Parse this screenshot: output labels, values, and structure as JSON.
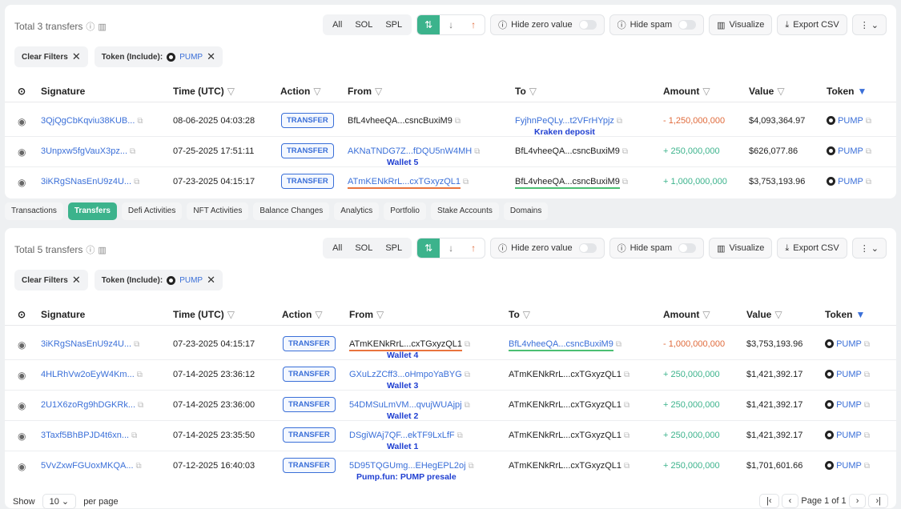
{
  "panel1": {
    "total": "Total 3 transfers",
    "chip_clear": "Clear Filters",
    "chip_token_label": "Token (Include):",
    "chip_token_value": "PUMP",
    "rows": [
      {
        "sig": "3QjQgCbKqviu38KUB...",
        "time": "08-06-2025 04:03:28",
        "action": "TRANSFER",
        "from": "BfL4vheeQA...csncBuxiM9",
        "to": "FyjhnPeQLy...t2VFrHYpjz",
        "amount": "- 1,250,000,000",
        "value": "$4,093,364.97",
        "token": "PUMP"
      },
      {
        "sig": "3Unpxw5fgVauX3pz...",
        "time": "07-25-2025 17:51:11",
        "action": "TRANSFER",
        "from": "AKNaTNDG7Z...fDQU5nW4MH",
        "to": "BfL4vheeQA...csncBuxiM9",
        "amount": "+ 250,000,000",
        "value": "$626,077.86",
        "token": "PUMP"
      },
      {
        "sig": "3iKRgSNasEnU9z4U...",
        "time": "07-23-2025 04:15:17",
        "action": "TRANSFER",
        "from": "ATmKENkRrL...cxTGxyzQL1",
        "to": "BfL4vheeQA...csncBuxiM9",
        "amount": "+ 1,000,000,000",
        "value": "$3,753,193.96",
        "token": "PUMP"
      }
    ],
    "annotations": {
      "kraken": "Kraken deposit",
      "wallet5": "Wallet 5"
    }
  },
  "toolbar": {
    "seg_all": "All",
    "seg_sol": "SOL",
    "seg_spl": "SPL",
    "sort_both": "⇅",
    "sort_down": "↓",
    "sort_up": "↑",
    "hide_zero": "Hide zero value",
    "hide_spam": "Hide spam",
    "visualize": "Visualize",
    "export": "Export CSV",
    "more": "⋮ ⌄"
  },
  "headers": {
    "signature": "Signature",
    "time": "Time (UTC)",
    "action": "Action",
    "from": "From",
    "to": "To",
    "amount": "Amount",
    "value": "Value",
    "token": "Token"
  },
  "tabs": [
    "Transactions",
    "Transfers",
    "Defi Activities",
    "NFT Activities",
    "Balance Changes",
    "Analytics",
    "Portfolio",
    "Stake Accounts",
    "Domains"
  ],
  "panel2": {
    "total": "Total 5 transfers",
    "chip_clear": "Clear Filters",
    "chip_token_label": "Token (Include):",
    "chip_token_value": "PUMP",
    "rows": [
      {
        "sig": "3iKRgSNasEnU9z4U...",
        "time": "07-23-2025 04:15:17",
        "action": "TRANSFER",
        "from": "ATmKENkRrL...cxTGxyzQL1",
        "to": "BfL4vheeQA...csncBuxiM9",
        "amount": "- 1,000,000,000",
        "value": "$3,753,193.96",
        "token": "PUMP",
        "note": "Wallet 4"
      },
      {
        "sig": "4HLRhVw2oEyW4Km...",
        "time": "07-14-2025 23:36:12",
        "action": "TRANSFER",
        "from": "GXuLzZCff3...oHmpoYaBYG",
        "to": "ATmKENkRrL...cxTGxyzQL1",
        "amount": "+ 250,000,000",
        "value": "$1,421,392.17",
        "token": "PUMP",
        "note": "Wallet 3"
      },
      {
        "sig": "2U1X6zoRg9hDGKRk...",
        "time": "07-14-2025 23:36:00",
        "action": "TRANSFER",
        "from": "54DMSuLmVM...qvujWUAjpj",
        "to": "ATmKENkRrL...cxTGxyzQL1",
        "amount": "+ 250,000,000",
        "value": "$1,421,392.17",
        "token": "PUMP",
        "note": "Wallet 2"
      },
      {
        "sig": "3Taxf5BhBPJD4t6xn...",
        "time": "07-14-2025 23:35:50",
        "action": "TRANSFER",
        "from": "DSgiWAj7QF...ekTF9LxLfF",
        "to": "ATmKENkRrL...cxTGxyzQL1",
        "amount": "+ 250,000,000",
        "value": "$1,421,392.17",
        "token": "PUMP",
        "note": "Wallet 1"
      },
      {
        "sig": "5VvZxwFGUoxMKQA...",
        "time": "07-12-2025 16:40:03",
        "action": "TRANSFER",
        "from": "5D95TQGUmg...EHegEPL2oj",
        "to": "ATmKENkRrL...cxTGxyzQL1",
        "amount": "+ 250,000,000",
        "value": "$1,701,601.66",
        "token": "PUMP",
        "note": "Pump.fun: PUMP presale"
      }
    ]
  },
  "pager": {
    "show": "Show",
    "size": "10",
    "per_page": "per page",
    "page_info": "Page 1 of 1"
  },
  "colors": {
    "accent": "#3cb38c",
    "link": "#3a6fd8",
    "negative": "#e06b3c",
    "annotation": "#1f3fd1"
  }
}
